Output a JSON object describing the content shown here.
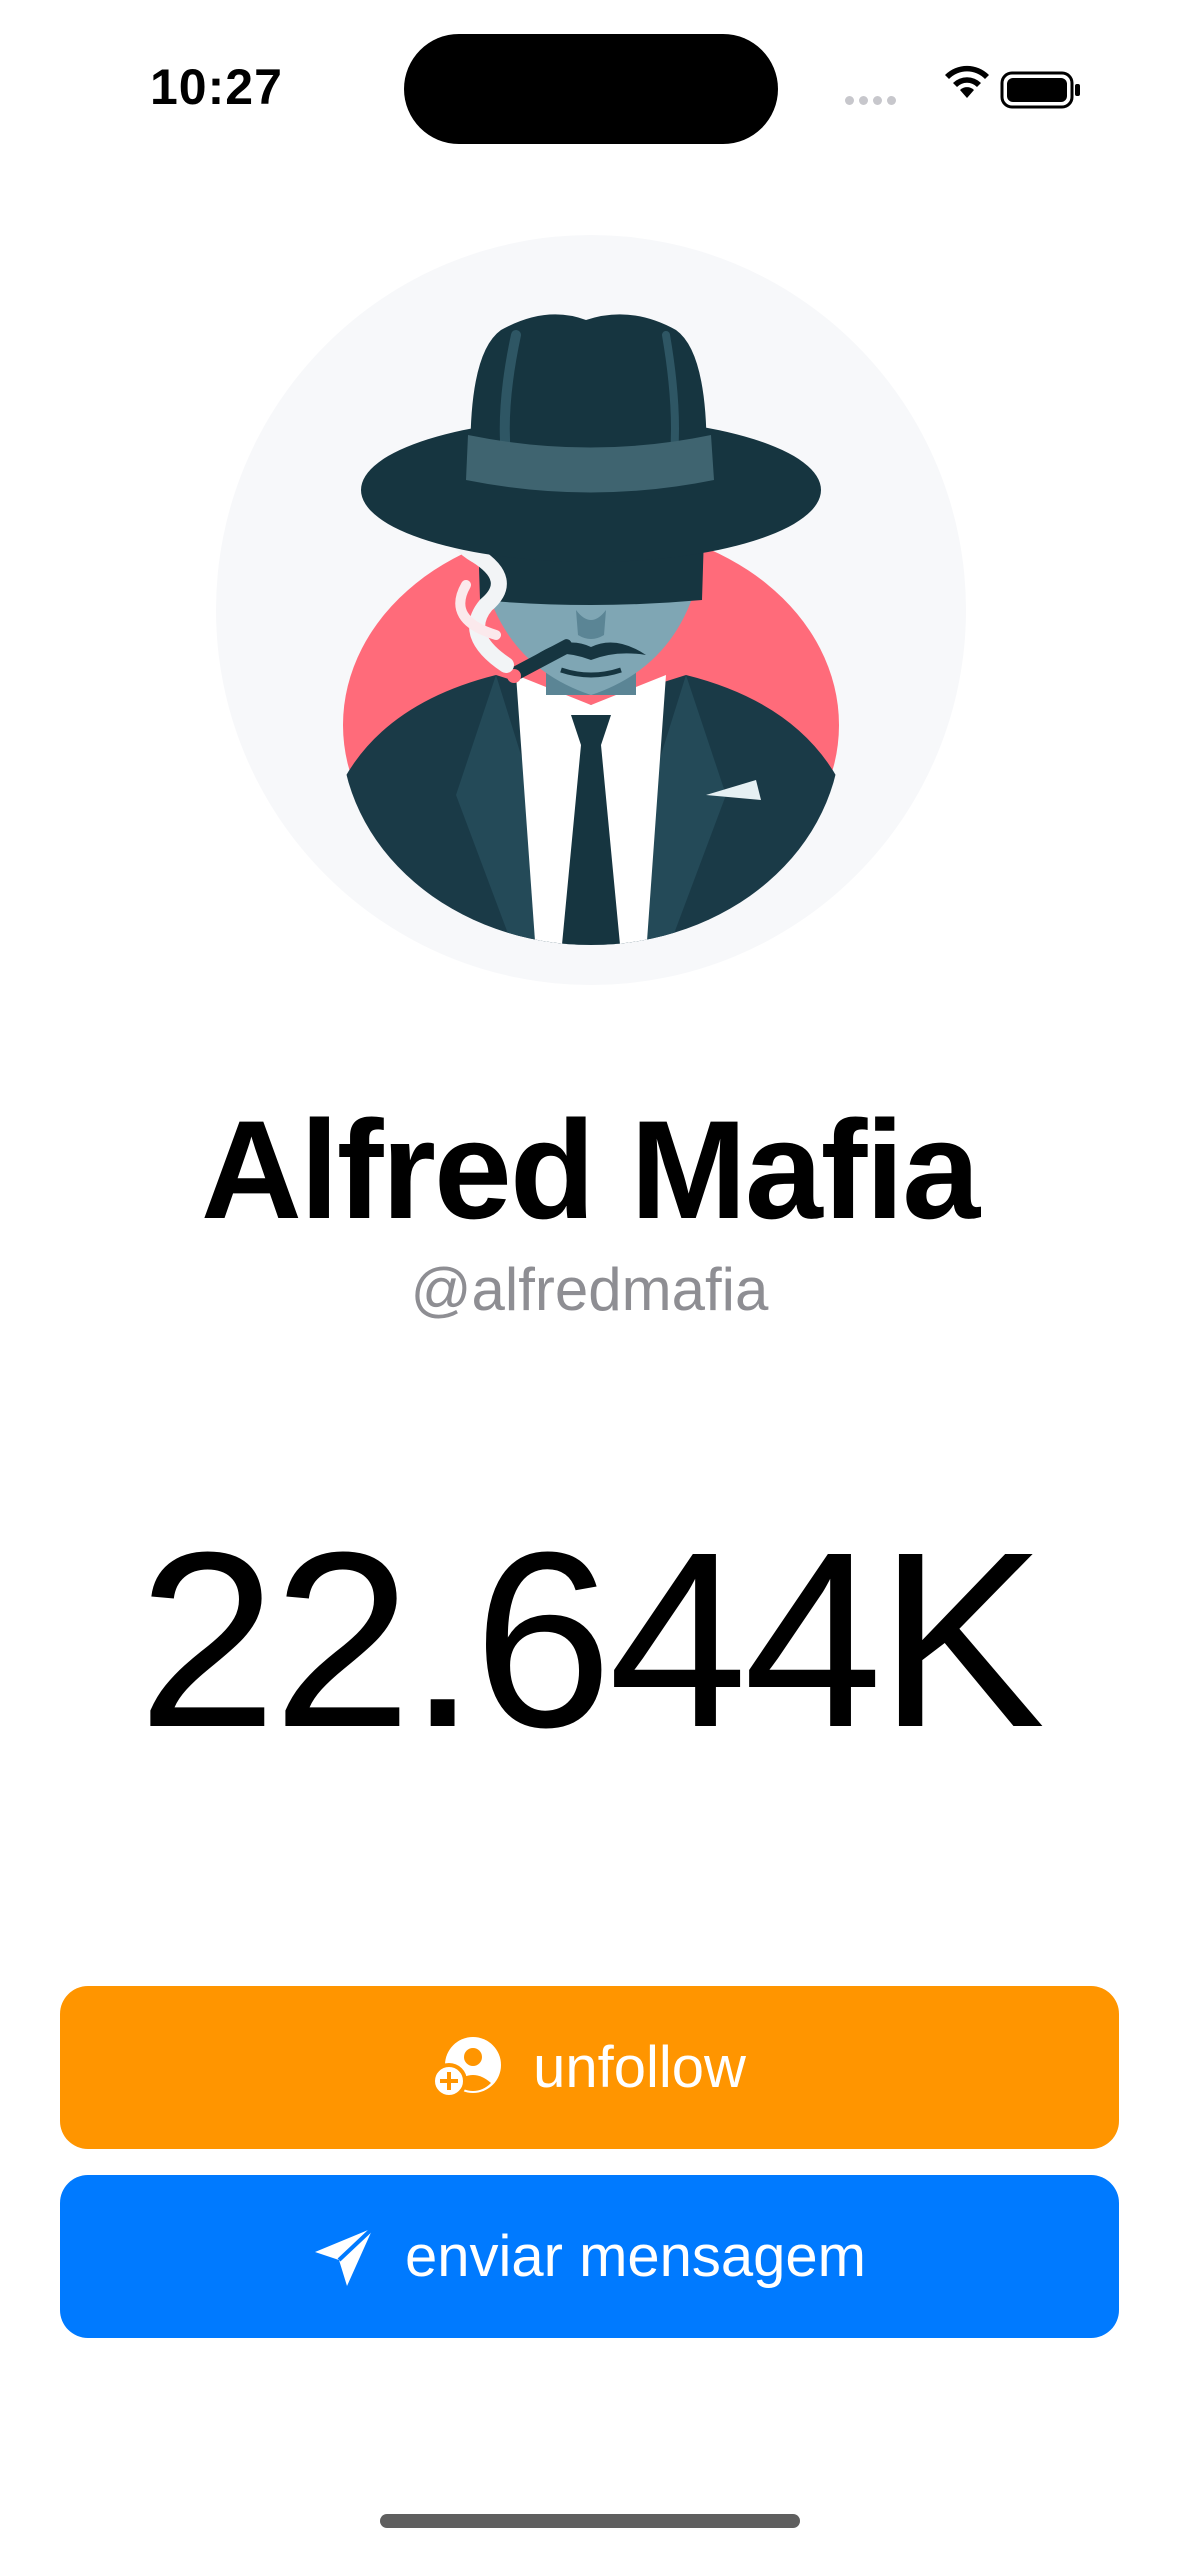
{
  "status_bar": {
    "time": "10:27"
  },
  "profile": {
    "avatar": "mafia-man-avatar",
    "name": "Alfred Mafia",
    "handle": "@alfredmafia",
    "followers_count": "22.644K"
  },
  "actions": {
    "unfollow_label": "unfollow",
    "unfollow_icon": "person-add-icon",
    "message_label": "enviar mensagem",
    "message_icon": "paper-plane-icon"
  },
  "colors": {
    "unfollow_button": "#ff9500",
    "message_button": "#007aff",
    "handle_text": "#8e8e93"
  }
}
